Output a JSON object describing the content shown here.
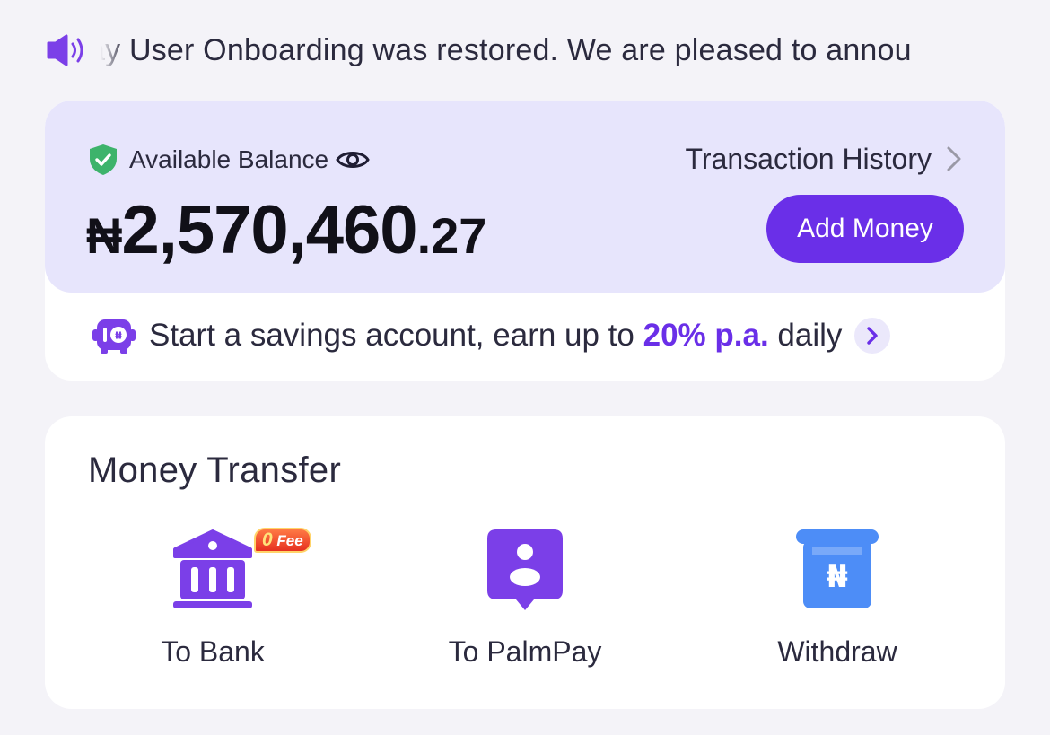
{
  "announcement": {
    "text": "ay User Onboarding was restored. We are pleased to annou"
  },
  "balance": {
    "label": "Available Balance",
    "currency_symbol": "₦",
    "amount_major": "2,570,460",
    "amount_minor": ".27",
    "history_label": "Transaction History",
    "add_money_label": "Add Money"
  },
  "savings": {
    "text_before": "Start a savings account, earn up to ",
    "rate": "20% p.a.",
    "text_after": " daily"
  },
  "transfer": {
    "title": "Money Transfer",
    "actions": [
      {
        "label": "To Bank",
        "icon": "bank-icon",
        "badge_zero": "0",
        "badge_text": "Fee"
      },
      {
        "label": "To PalmPay",
        "icon": "user-location-icon"
      },
      {
        "label": "Withdraw",
        "icon": "atm-withdraw-icon"
      }
    ]
  },
  "colors": {
    "brand_purple": "#6a2fe8",
    "card_lavender": "#e7e5fc",
    "shield_green": "#3db36b",
    "atm_blue": "#4d8df7",
    "background": "#f4f3f8"
  }
}
